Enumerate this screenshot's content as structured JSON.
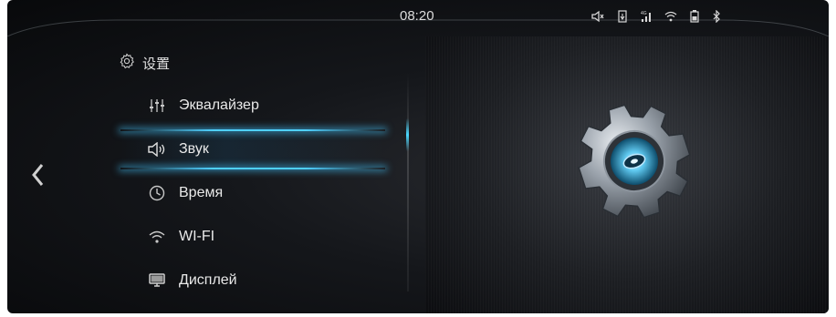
{
  "status_bar": {
    "time": "08:20",
    "icons": [
      "volume-mute-icon",
      "usb-icon",
      "signal-icon",
      "wifi-icon",
      "battery-icon",
      "bluetooth-icon"
    ]
  },
  "header": {
    "icon": "gear-icon",
    "title": "设置"
  },
  "menu": {
    "items": [
      {
        "label": "Эквалайзер",
        "icon": "equalizer-icon",
        "active": false
      },
      {
        "label": "Звук",
        "icon": "speaker-icon",
        "active": true
      },
      {
        "label": "Время",
        "icon": "clock-icon",
        "active": false
      },
      {
        "label": "WI-FI",
        "icon": "wifi-icon",
        "active": false
      },
      {
        "label": "Дисплей",
        "icon": "display-icon",
        "active": false
      }
    ]
  },
  "navigation": {
    "back_icon": "chevron-left-icon"
  },
  "colors": {
    "accent": "#4fd0ff",
    "background": "#101215",
    "text": "#e9e9e9"
  }
}
